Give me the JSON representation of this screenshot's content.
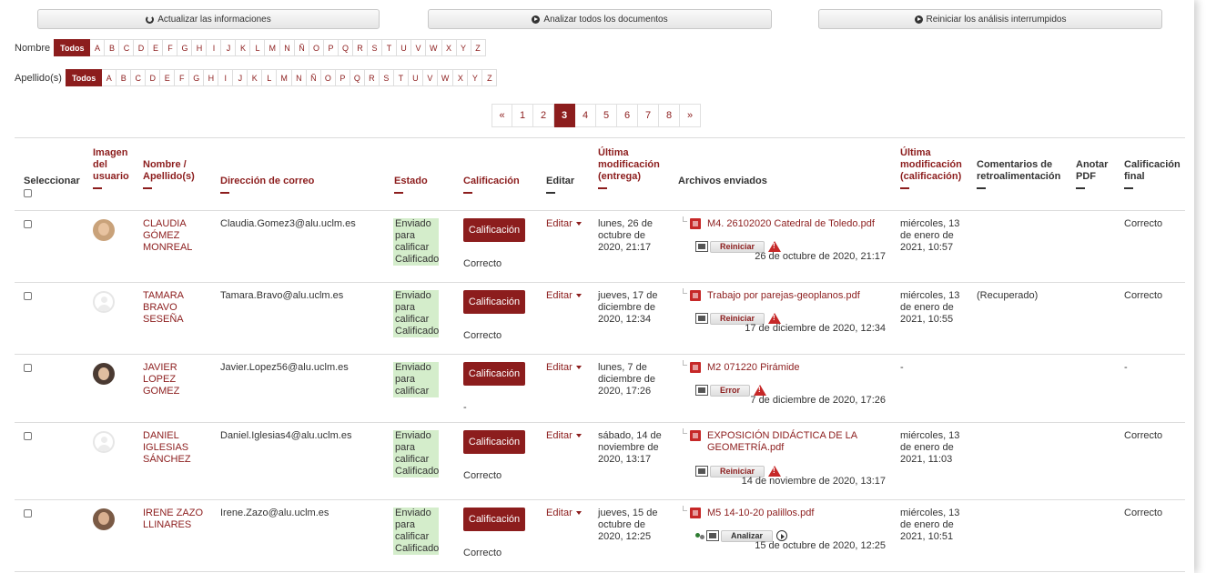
{
  "toolbar": {
    "refresh_label": "Actualizar las informaciones",
    "analyze_all_label": "Analizar todos los documentos",
    "restart_label": "Reiniciar los análisis interrumpidos"
  },
  "filters": {
    "first_name_label": "Nombre",
    "last_name_label": "Apellido(s)",
    "all_label": "Todos",
    "letters": [
      "A",
      "B",
      "C",
      "D",
      "E",
      "F",
      "G",
      "H",
      "I",
      "J",
      "K",
      "L",
      "M",
      "N",
      "Ñ",
      "O",
      "P",
      "Q",
      "R",
      "S",
      "T",
      "U",
      "V",
      "W",
      "X",
      "Y",
      "Z"
    ]
  },
  "pagination": {
    "prev": "«",
    "pages": [
      "1",
      "2",
      "3",
      "4",
      "5",
      "6",
      "7",
      "8"
    ],
    "current": "3",
    "next": "»"
  },
  "table": {
    "headers": {
      "select": "Seleccionar",
      "image": "Imagen del usuario",
      "name": "Nombre / Apellido(s)",
      "email": "Dirección de correo",
      "status": "Estado",
      "grade": "Calificación",
      "edit": "Editar",
      "last_modified_submission": "Última modificación (entrega)",
      "files": "Archivos enviados",
      "last_modified_grade": "Última modificación (calificación)",
      "feedback": "Comentarios de retroalimentación",
      "annotate": "Anotar PDF",
      "final_grade": "Calificación final"
    },
    "grade_button_label": "Calificación",
    "edit_label": "Editar",
    "rows": [
      {
        "name": "CLAUDIA GÓMEZ MONREAL",
        "email": "Claudia.Gomez3@alu.uclm.es",
        "status": "Enviado para calificar Calificado",
        "grade": "Correcto",
        "modified": "lunes, 26 de octubre de 2020, 21:17",
        "file_name": "M4. 26102020 Catedral de Toledo.pdf",
        "action": "Reiniciar",
        "file_date": "26 de octubre de 2020, 21:17",
        "grade_modified": "miércoles, 13 de enero de 2021, 10:57",
        "feedback": "",
        "final": "Correcto"
      },
      {
        "name": "TAMARA BRAVO SESEÑA",
        "email": "Tamara.Bravo@alu.uclm.es",
        "status": "Enviado para calificar Calificado",
        "grade": "Correcto",
        "modified": "jueves, 17 de diciembre de 2020, 12:34",
        "file_name": "Trabajo por parejas-geoplanos.pdf",
        "action": "Reiniciar",
        "file_date": "17 de diciembre de 2020, 12:34",
        "grade_modified": "miércoles, 13 de enero de 2021, 10:55",
        "feedback": "(Recuperado)",
        "final": "Correcto"
      },
      {
        "name": "JAVIER LOPEZ GOMEZ",
        "email": "Javier.Lopez56@alu.uclm.es",
        "status": "Enviado para calificar",
        "grade": "-",
        "modified": "lunes, 7 de diciembre de 2020, 17:26",
        "file_name": "M2 071220 Pirámide",
        "action": "Error",
        "file_date": "7 de diciembre de 2020, 17:26",
        "grade_modified": "-",
        "feedback": "",
        "final": "-"
      },
      {
        "name": "DANIEL IGLESIAS SÁNCHEZ",
        "email": "Daniel.Iglesias4@alu.uclm.es",
        "status": "Enviado para calificar Calificado",
        "grade": "Correcto",
        "modified": "sábado, 14 de noviembre de 2020, 13:17",
        "file_name": "EXPOSICIÓN DIDÁCTICA DE LA GEOMETRÍA.pdf",
        "action": "Reiniciar",
        "file_date": "14 de noviembre de 2020, 13:17",
        "grade_modified": "miércoles, 13 de enero de 2021, 11:03",
        "feedback": "",
        "final": "Correcto"
      },
      {
        "name": "IRENE ZAZO LLINARES",
        "email": "Irene.Zazo@alu.uclm.es",
        "status": "Enviado para calificar Calificado",
        "grade": "Correcto",
        "modified": "jueves, 15 de octubre de 2020, 12:25",
        "file_name": "M5 14-10-20 palillos.pdf",
        "action": "Analizar",
        "file_date": "15 de octubre de 2020, 12:25",
        "grade_modified": "miércoles, 13 de enero de 2021, 10:51",
        "feedback": "",
        "final": "Correcto"
      }
    ]
  }
}
